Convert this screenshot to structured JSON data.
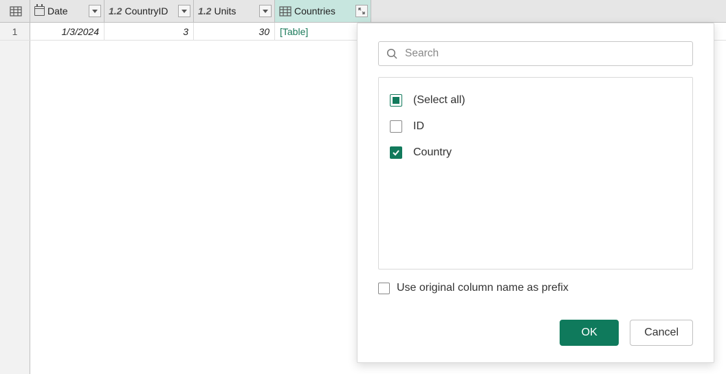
{
  "columns": {
    "date": {
      "label": "Date"
    },
    "countryId": {
      "label": "CountryID",
      "typeIcon": "1.2"
    },
    "units": {
      "label": "Units",
      "typeIcon": "1.2"
    },
    "countries": {
      "label": "Countries"
    }
  },
  "rows": [
    {
      "index": "1",
      "date": "1/3/2024",
      "countryId": "3",
      "units": "30",
      "countries": "[Table]"
    }
  ],
  "popup": {
    "search_placeholder": "Search",
    "fields": {
      "select_all_label": "(Select all)",
      "id_label": "ID",
      "country_label": "Country"
    },
    "prefix_label": "Use original column name as prefix",
    "ok_label": "OK",
    "cancel_label": "Cancel"
  }
}
